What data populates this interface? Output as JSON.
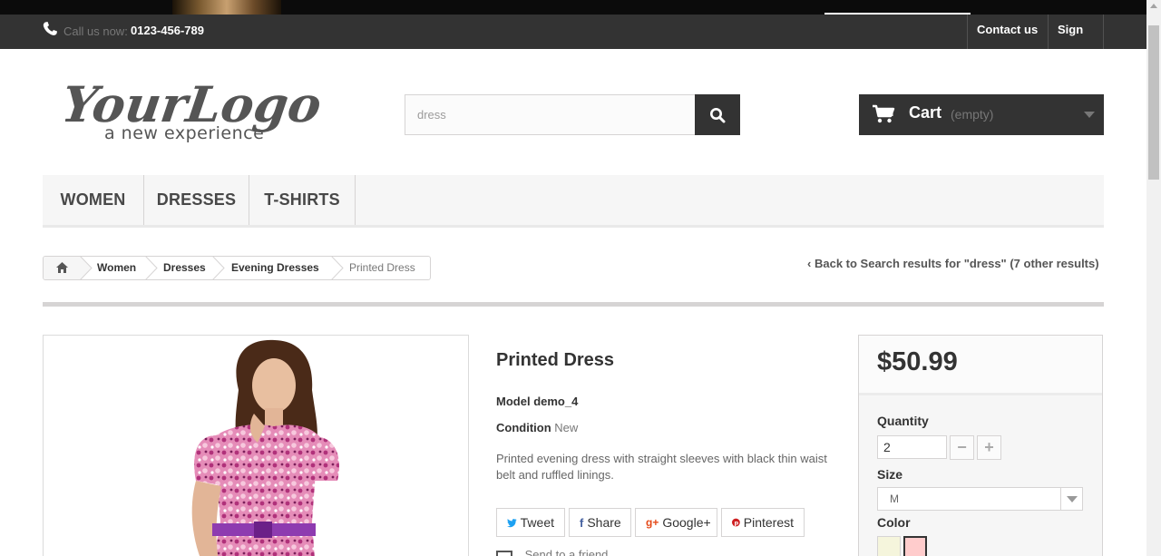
{
  "header": {
    "call_label": "Call us now:",
    "phone": "0123-456-789",
    "contact_label": "Contact us",
    "signin_label": "Sign in"
  },
  "logo": {
    "wordmark": "YourLogo",
    "tagline": "a new experience"
  },
  "search": {
    "value": "dress"
  },
  "cart": {
    "label": "Cart",
    "status": "(empty)"
  },
  "menu": {
    "items": [
      {
        "label": "WOMEN"
      },
      {
        "label": "DRESSES"
      },
      {
        "label": "T-SHIRTS"
      }
    ]
  },
  "breadcrumb": {
    "items": [
      "Women",
      "Dresses",
      "Evening Dresses"
    ],
    "current": "Printed Dress"
  },
  "back_link": "Back to Search results for \"dress\" (7 other results)",
  "product": {
    "title": "Printed Dress",
    "model_label": "Model",
    "model_value": "demo_4",
    "condition_label": "Condition",
    "condition_value": "New",
    "description": "Printed evening dress with straight sleeves with black thin waist belt and ruffled linings.",
    "social": {
      "tweet": "Tweet",
      "share": "Share",
      "google": "Google+",
      "pinterest": "Pinterest"
    },
    "send_to_friend": "Send to a friend"
  },
  "buy": {
    "price": "$50.99",
    "quantity_label": "Quantity",
    "quantity_value": "2",
    "size_label": "Size",
    "size_value": "M",
    "color_label": "Color",
    "colors": [
      "#f5f5dc",
      "#ffcccc"
    ]
  },
  "colors": {
    "dark": "#333333",
    "twitter": "#1da1f2",
    "facebook": "#435f9f",
    "google": "#e54a19",
    "pinterest": "#ce1f21"
  }
}
